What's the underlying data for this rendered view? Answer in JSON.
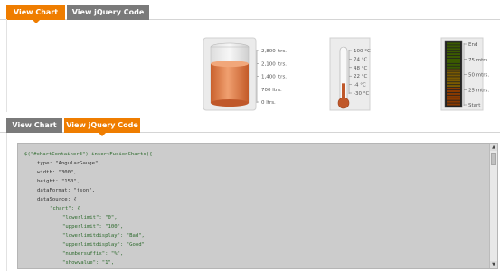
{
  "top_tabs": {
    "chart_label": "View Chart",
    "code_label": "View jQuery Code"
  },
  "bottom_tabs": {
    "chart_label": "View Chart",
    "code_label": "View jQuery Code"
  },
  "cylinder_gauge": {
    "ticks": [
      "2,800 ltrs.",
      "2,100 ltrs.",
      "1,400 ltrs.",
      "700 ltrs.",
      "0 ltrs."
    ],
    "fill_fraction": 0.7,
    "fill_color": "#e07a45"
  },
  "thermometer_gauge": {
    "ticks": [
      "100 °C",
      "74 °C",
      "48 °C",
      "22 °C",
      "-4 °C",
      "-30 °C"
    ],
    "fill_fraction": 0.22,
    "fill_color": "#c0582a"
  },
  "led_gauge": {
    "ticks": [
      "End",
      "75 mtrs.",
      "50 mtrs.",
      "25 mtrs.",
      "Start"
    ],
    "colors": [
      "#3b5a00",
      "#7a5a00",
      "#8a3a00"
    ]
  },
  "code_lines": [
    {
      "t": "$(\"#chartContainer3\").insertFusionCharts({",
      "c": "#2d6a2d",
      "i": 0
    },
    {
      "t": "type: \"AngularGauge\",",
      "c": "#333",
      "i": 1
    },
    {
      "t": "width: \"300\",",
      "c": "#333",
      "i": 1
    },
    {
      "t": "height: \"150\",",
      "c": "#333",
      "i": 1
    },
    {
      "t": "dataFormat: \"json\",",
      "c": "#333",
      "i": 1
    },
    {
      "t": "dataSource: {",
      "c": "#333",
      "i": 1
    },
    {
      "t": "\"chart\": {",
      "c": "#2d6a2d",
      "i": 2
    },
    {
      "t": "\"lowerlimit\": \"0\",",
      "c": "#2d6a2d",
      "i": 3
    },
    {
      "t": "\"upperlimit\": \"100\",",
      "c": "#2d6a2d",
      "i": 3
    },
    {
      "t": "\"lowerlimitdisplay\": \"Bad\",",
      "c": "#2d6a2d",
      "i": 3
    },
    {
      "t": "\"upperlimitdisplay\": \"Good\",",
      "c": "#2d6a2d",
      "i": 3
    },
    {
      "t": "\"numbersuffix\": \"%\",",
      "c": "#2d6a2d",
      "i": 3
    },
    {
      "t": "\"showvalue\": \"1\",",
      "c": "#2d6a2d",
      "i": 3
    }
  ]
}
